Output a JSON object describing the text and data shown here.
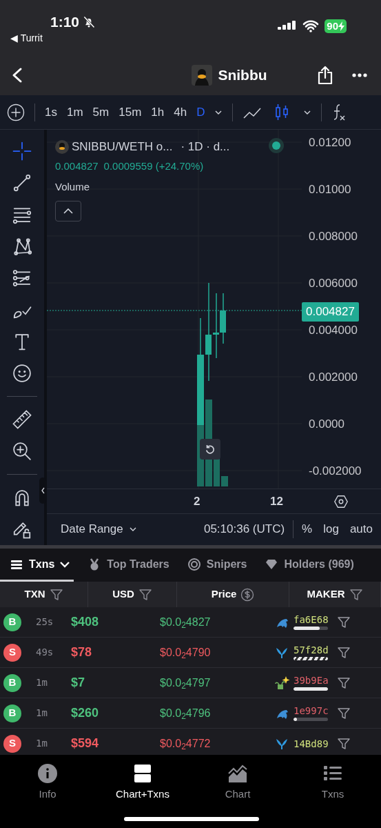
{
  "status_bar": {
    "time": "1:10",
    "back_app": "◀ Turrit",
    "battery": "90"
  },
  "header": {
    "title": "Snibbu"
  },
  "toolbar": {
    "intervals": [
      {
        "label": "1s",
        "selected": false
      },
      {
        "label": "1m",
        "selected": false
      },
      {
        "label": "5m",
        "selected": false
      },
      {
        "label": "15m",
        "selected": false
      },
      {
        "label": "1h",
        "selected": false
      },
      {
        "label": "4h",
        "selected": false
      },
      {
        "label": "D",
        "selected": true
      }
    ],
    "chart_types": [
      {
        "kind": "line",
        "selected": false
      },
      {
        "kind": "candles",
        "selected": true
      }
    ]
  },
  "tool_groups": [
    {
      "tools": [
        {
          "kind": "crosshair",
          "selected": true
        },
        {
          "kind": "trend",
          "selected": false
        },
        {
          "kind": "hlines",
          "selected": false
        },
        {
          "kind": "pattern",
          "selected": false
        },
        {
          "kind": "fib",
          "selected": false
        },
        {
          "kind": "brush",
          "selected": false
        },
        {
          "kind": "text",
          "selected": false
        },
        {
          "kind": "smile",
          "selected": false
        }
      ]
    },
    {
      "tools": [
        {
          "kind": "ruler",
          "selected": false
        },
        {
          "kind": "zoom",
          "selected": false
        }
      ]
    },
    {
      "tools": [
        {
          "kind": "magnet",
          "selected": false
        },
        {
          "kind": "pencillock",
          "selected": false
        }
      ]
    }
  ],
  "chart": {
    "symbol": "SNIBBU/WETH o...",
    "interval": "· 1D · d...",
    "last": "0.004827",
    "change": "0.0009559 (+24.70%)",
    "volume_label": "Volume",
    "y_labels": [
      "0.01200",
      "0.01000",
      "0.008000",
      "0.006000",
      "0.004000",
      "0.002000",
      "0.0000",
      "-0.002000"
    ],
    "price_tag": "0.004827",
    "x_labels": [
      "2",
      "12"
    ],
    "date_range": "Date Range",
    "time": "05:10:36 (UTC)",
    "scale_options": [
      "%",
      "log",
      "auto"
    ]
  },
  "tabs": [
    {
      "label": "Txns",
      "kind": "list",
      "selected": true
    },
    {
      "label": "Top Traders",
      "kind": "medal",
      "selected": false
    },
    {
      "label": "Snipers",
      "kind": "target",
      "selected": false
    },
    {
      "label": "Holders (969)",
      "kind": "diamond",
      "selected": false
    }
  ],
  "table": {
    "columns": [
      {
        "label": "TXN"
      },
      {
        "label": "USD"
      },
      {
        "label": "Price"
      },
      {
        "label": "MAKER"
      }
    ],
    "rows": [
      {
        "kind": "buy",
        "badge": "B",
        "age": "25s",
        "usd": "$408",
        "price": "$0.0$_{2}$4827",
        "maker": {
          "kind": "dolphin",
          "address": "fa6E68",
          "color": "#cfe07c"
        },
        "bar": {
          "kind": "solid",
          "level": 0.76
        }
      },
      {
        "kind": "sell",
        "badge": "S",
        "age": "49s",
        "usd": "$78",
        "price": "$0.0$_{2}$4790",
        "maker": {
          "kind": "whale",
          "address": "57f28d",
          "color": "#cfe07c"
        },
        "bar": {
          "kind": "striped",
          "level": 1
        }
      },
      {
        "kind": "buy",
        "badge": "B",
        "age": "1m",
        "usd": "$7",
        "price": "$0.0$_{2}$4797",
        "maker": {
          "kind": "plant",
          "address": "39b9Ea",
          "color": "#e2616a"
        },
        "bar": {
          "kind": "solid",
          "level": 1
        }
      },
      {
        "kind": "buy",
        "badge": "B",
        "age": "1m",
        "usd": "$260",
        "price": "$0.0$_{2}$4796",
        "maker": {
          "kind": "dolphin",
          "address": "1e997c",
          "color": "#e2616a"
        },
        "bar": {
          "kind": "solid",
          "level": 0.1
        }
      },
      {
        "kind": "sell",
        "badge": "S",
        "age": "1m",
        "usd": "$594",
        "price": "$0.0$_{2}$4772",
        "maker": {
          "kind": "whale",
          "address": "14Bd89",
          "color": "#cfe07c"
        }
      }
    ]
  },
  "bottom_nav": [
    {
      "label": "Info",
      "kind": "info",
      "selected": false
    },
    {
      "label": "Chart+Txns",
      "kind": "split",
      "selected": true
    },
    {
      "label": "Chart",
      "kind": "area",
      "selected": false
    },
    {
      "label": "Txns",
      "kind": "list",
      "selected": false
    }
  ]
}
